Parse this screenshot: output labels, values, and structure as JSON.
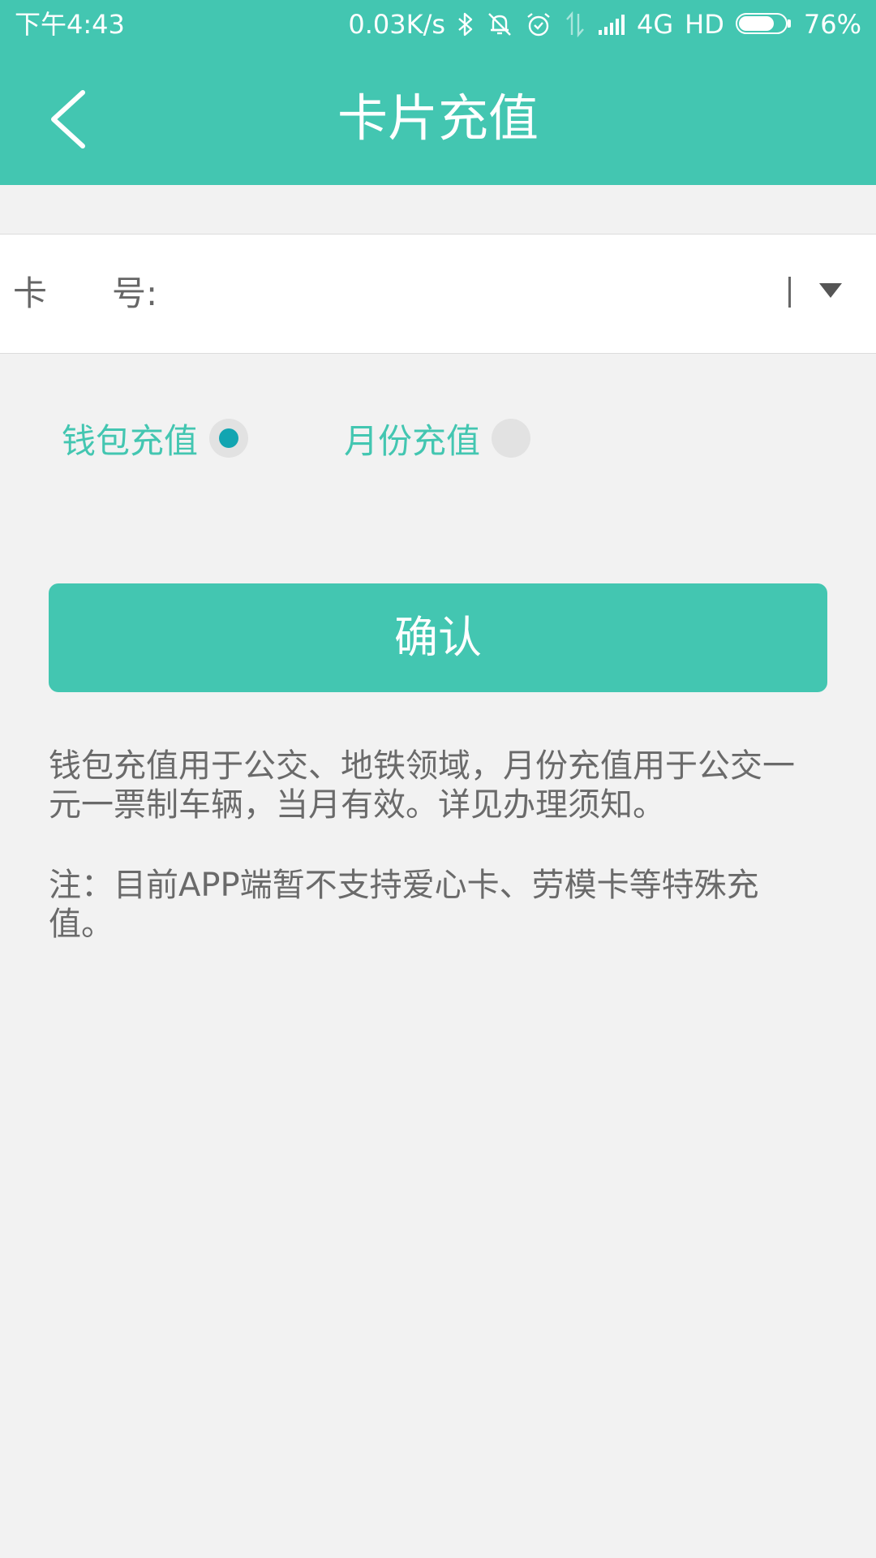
{
  "status_bar": {
    "time": "下午4:43",
    "net_speed": "0.03K/s",
    "network": "4G",
    "hd": "HD",
    "battery_text": "76%",
    "battery_level": 0.76
  },
  "header": {
    "title": "卡片充值",
    "color": "#43c6b1"
  },
  "card_field": {
    "label_char_1": "卡",
    "label_char_2": "号:",
    "value": "",
    "placeholder": ""
  },
  "options": {
    "wallet": {
      "label": "钱包充值",
      "selected": true
    },
    "month": {
      "label": "月份充值",
      "selected": false
    }
  },
  "confirm": {
    "label": "确认"
  },
  "notices": {
    "line_1": "钱包充值用于公交、地铁领域，月份充值用于公交一元一票制车辆，当月有效。详见办理须知。",
    "line_2": "注：目前APP端暂不支持爱心卡、劳模卡等特殊充值。"
  },
  "icons": [
    "back-arrow-icon",
    "bluetooth-icon",
    "mute-icon",
    "alarm-icon",
    "data-transfer-icon",
    "signal-icon",
    "battery-icon",
    "dropdown-arrow-icon"
  ]
}
